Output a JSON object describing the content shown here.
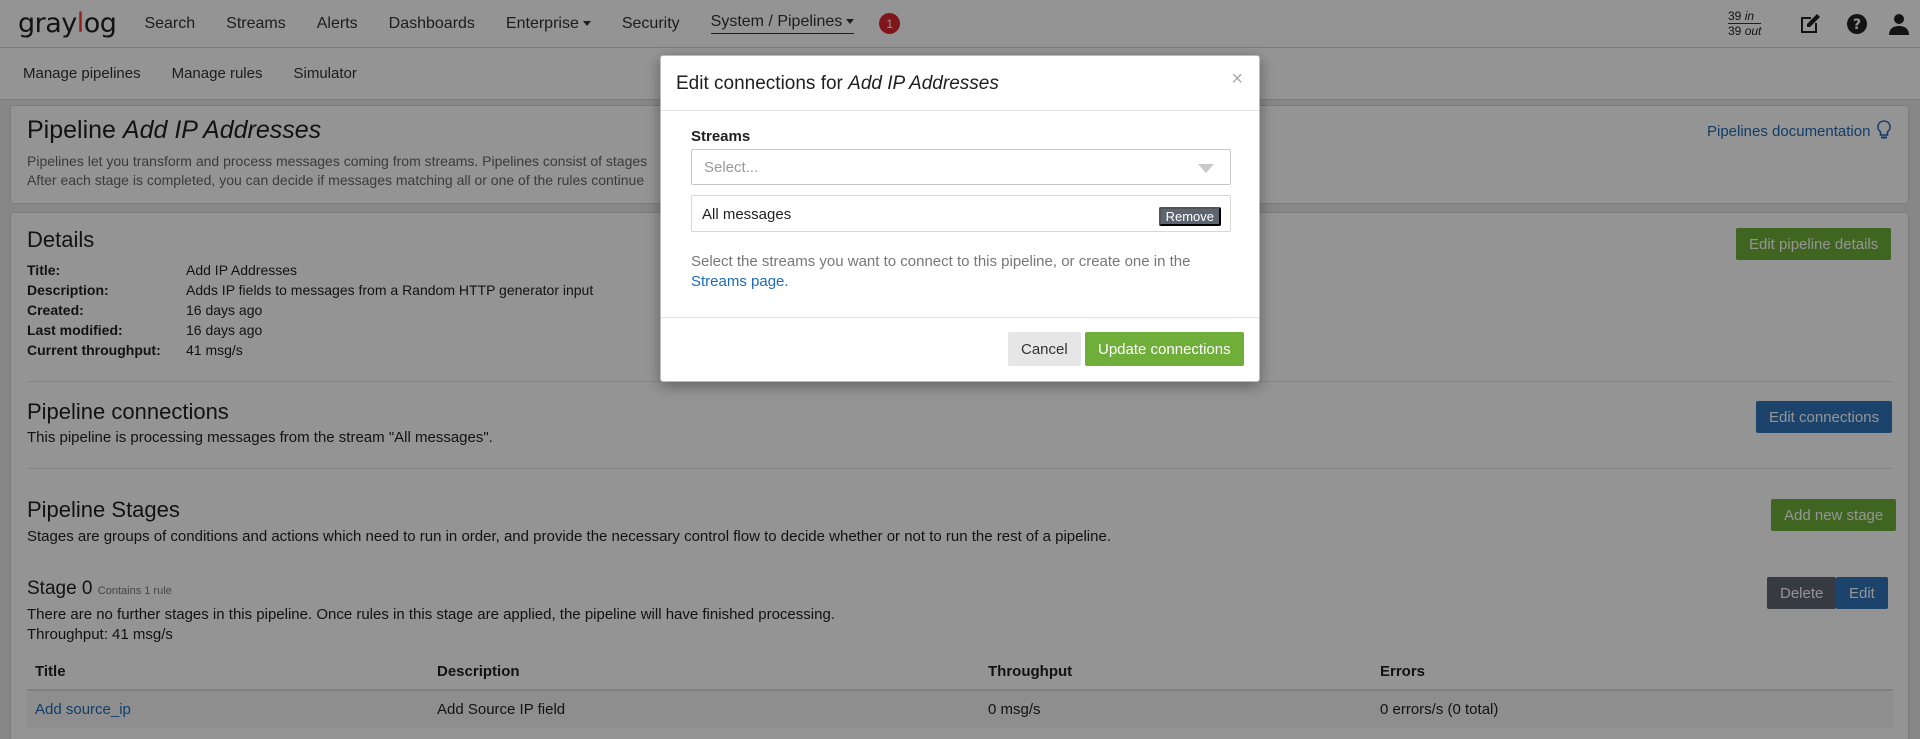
{
  "topnav": {
    "logo_pre": "gray",
    "logo_o": "l",
    "logo_post": "og",
    "items": [
      "Search",
      "Streams",
      "Alerts",
      "Dashboards",
      "Enterprise",
      "Security",
      "System / Pipelines"
    ],
    "notifications": "1",
    "throughput_in": "39",
    "throughput_in_label": "in",
    "throughput_out": "39",
    "throughput_out_label": "out"
  },
  "subnav": {
    "items": [
      "Manage pipelines",
      "Manage rules",
      "Simulator"
    ]
  },
  "header": {
    "title_prefix": "Pipeline",
    "title_name": "Add IP Addresses",
    "desc1": "Pipelines let you transform and process messages coming from streams. Pipelines consist of stages",
    "desc2": "After each stage is completed, you can decide if messages matching all or one of the rules continue",
    "docs_link": "Pipelines documentation"
  },
  "details": {
    "heading": "Details",
    "edit_button": "Edit pipeline details",
    "rows": [
      {
        "label": "Title:",
        "value": "Add IP Addresses"
      },
      {
        "label": "Description:",
        "value": "Adds IP fields to messages from a Random HTTP generator input"
      },
      {
        "label": "Created:",
        "value": "16 days ago"
      },
      {
        "label": "Last modified:",
        "value": "16 days ago"
      },
      {
        "label": "Current throughput:",
        "value": "41 msg/s"
      }
    ]
  },
  "connections": {
    "heading": "Pipeline connections",
    "text": "This pipeline is processing messages from the stream \"All messages\".",
    "edit_button": "Edit connections"
  },
  "stages": {
    "heading": "Pipeline Stages",
    "text": "Stages are groups of conditions and actions which need to run in order, and provide the necessary control flow to decide whether or not to run the rest of a pipeline.",
    "add_button": "Add new stage",
    "stage_title": "Stage 0",
    "stage_sub": "Contains 1 rule",
    "stage_text": "There are no further stages in this pipeline. Once rules in this stage are applied, the pipeline will have finished processing.",
    "stage_throughput": "Throughput: 41 msg/s",
    "delete_button": "Delete",
    "edit_button": "Edit",
    "columns": [
      "Title",
      "Description",
      "Throughput",
      "Errors"
    ],
    "rows": [
      {
        "title": "Add source_ip",
        "description": "Add Source IP field",
        "throughput": "0 msg/s",
        "errors": "0 errors/s (0 total)"
      }
    ]
  },
  "modal": {
    "title_prefix": "Edit connections for",
    "title_name": "Add IP Addresses",
    "close": "×",
    "field_label": "Streams",
    "placeholder": "Select...",
    "selected_stream": "All messages",
    "remove_button": "Remove",
    "help_text": "Select the streams you want to connect to this pipeline, or create one in the",
    "help_link": "Streams page.",
    "cancel_button": "Cancel",
    "update_button": "Update connections"
  },
  "colors": {
    "accent_green": "#6fae39",
    "accent_blue": "#2f74b8",
    "link": "#1f6ab6",
    "logo_red": "#ff3633",
    "badge_red": "#d9262f"
  }
}
